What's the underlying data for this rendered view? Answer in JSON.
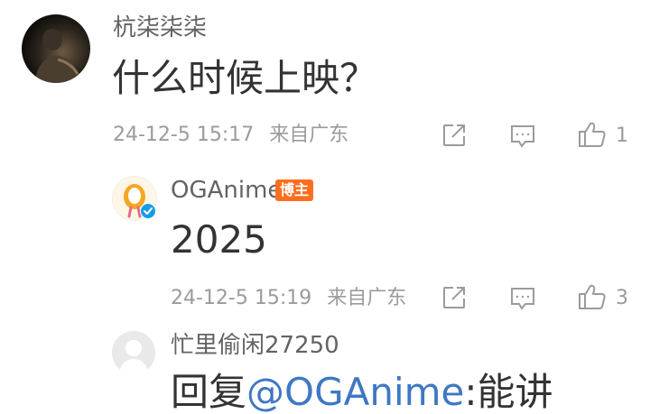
{
  "comments": [
    {
      "username": "杭柒柒柒",
      "text": "什么时候上映？",
      "date": "24-12-5 15:17",
      "location": "来自广东",
      "likes": "1"
    },
    {
      "username": "OGAnime",
      "badge": "博主",
      "text": "2025",
      "date": "24-12-5 15:19",
      "location": "来自广东",
      "likes": "3"
    },
    {
      "username": "忙里偷闲27250",
      "reply_prefix": "回复",
      "reply_mention": "@OGAnime",
      "reply_suffix": ":能讲"
    }
  ],
  "icons": {
    "share": "share-icon",
    "comment": "comment-icon",
    "like": "thumbs-up-icon",
    "verified": "verified-badge-icon"
  },
  "colors": {
    "badge": "#ff6e1f",
    "mention": "#3e78c4",
    "verified": "#1a9ce8",
    "meta": "#9b9b9b"
  }
}
